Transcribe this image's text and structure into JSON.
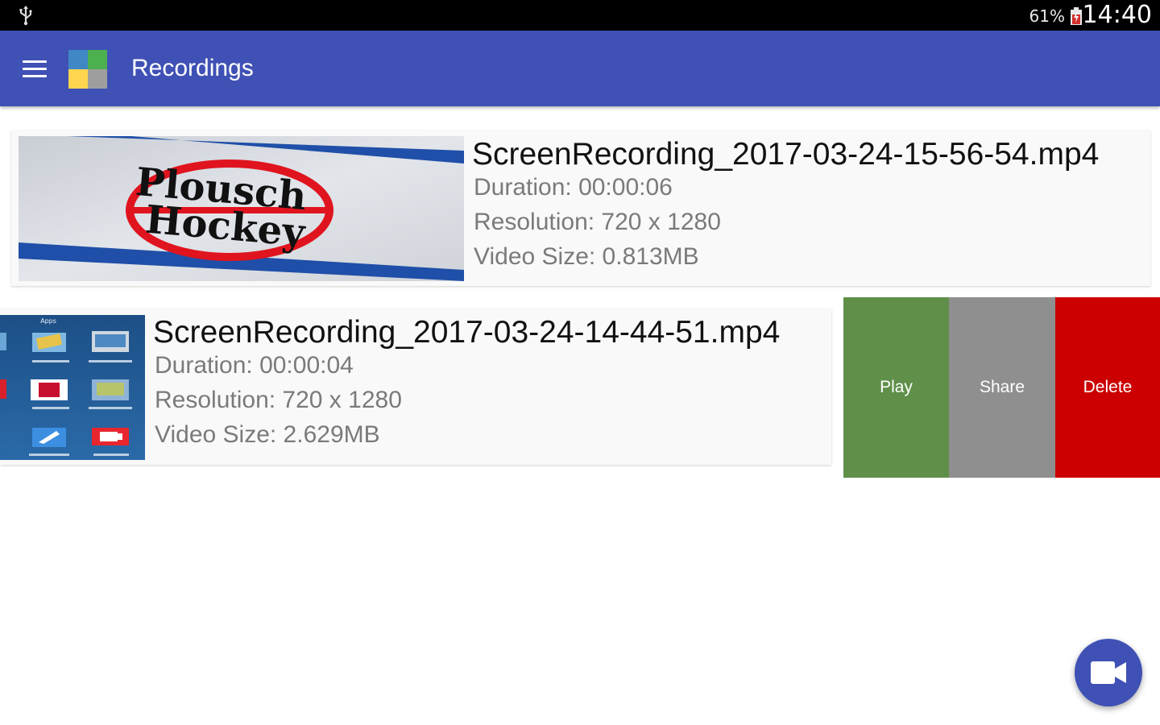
{
  "status_bar": {
    "battery_percent": "61%",
    "time": "14:40",
    "icons": [
      "usb-icon",
      "battery-charging-icon"
    ]
  },
  "app_bar": {
    "title": "Recordings",
    "icons": [
      "menu-icon",
      "app-logo-icon"
    ]
  },
  "recordings": [
    {
      "file_name": "ScreenRecording_2017-03-24-15-56-54.mp4",
      "duration": "Duration: 00:00:06",
      "resolution": "Resolution: 720 x 1280",
      "size": "Video Size: 0.813MB",
      "thumbnail": {
        "line1": "Plousch",
        "line2": "Hockey"
      }
    },
    {
      "file_name": "ScreenRecording_2017-03-24-14-44-51.mp4",
      "duration": "Duration: 00:00:04",
      "resolution": "Resolution: 720 x 1280",
      "size": "Video Size: 2.629MB",
      "thumbnail": {
        "header": "Apps"
      }
    }
  ],
  "swipe_actions": {
    "play": "Play",
    "share": "Share",
    "delete": "Delete"
  },
  "colors": {
    "primary": "#3f51b5",
    "play": "#5f8f49",
    "share": "#8f8f8f",
    "delete": "#cc0000"
  },
  "fab": {
    "icon": "video-camera-icon"
  }
}
